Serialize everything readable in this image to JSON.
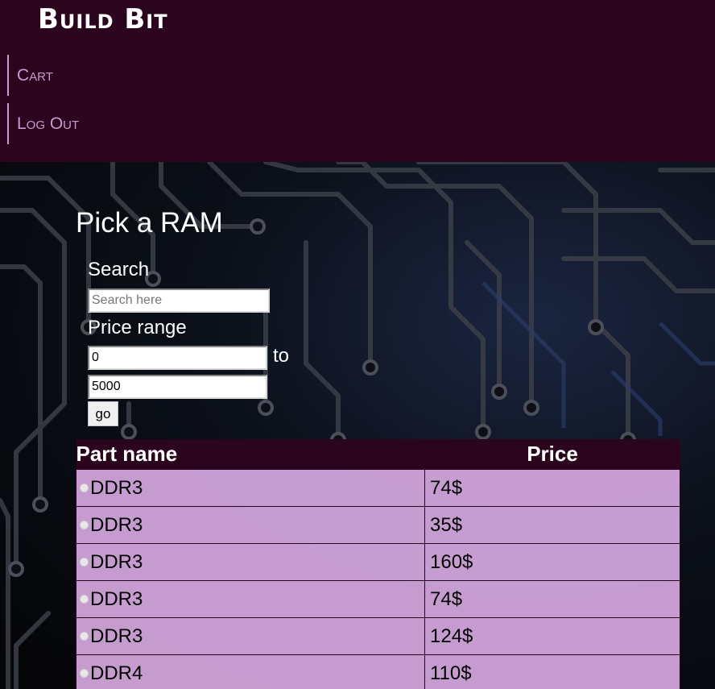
{
  "brand": "Build Bit",
  "nav": {
    "cart": "Cart",
    "logout": "Log Out"
  },
  "page": {
    "title": "Pick a RAM"
  },
  "filters": {
    "search_label": "Search",
    "search_placeholder": "Search here",
    "price_range_label": "Price range",
    "min_value": "0",
    "to_label": "to",
    "max_value": "5000",
    "go_label": "go"
  },
  "table": {
    "headers": {
      "name": "Part name",
      "price": "Price"
    },
    "rows": [
      {
        "name": "DDR3",
        "price": "74$"
      },
      {
        "name": "DDR3",
        "price": "35$"
      },
      {
        "name": "DDR3",
        "price": "160$"
      },
      {
        "name": "DDR3",
        "price": "74$"
      },
      {
        "name": "DDR3",
        "price": "124$"
      },
      {
        "name": "DDR4",
        "price": "110$"
      }
    ]
  },
  "colors": {
    "header_bg": "#2b051e",
    "nav_text": "#c79bd1",
    "row_bg": "#d5a8df"
  }
}
